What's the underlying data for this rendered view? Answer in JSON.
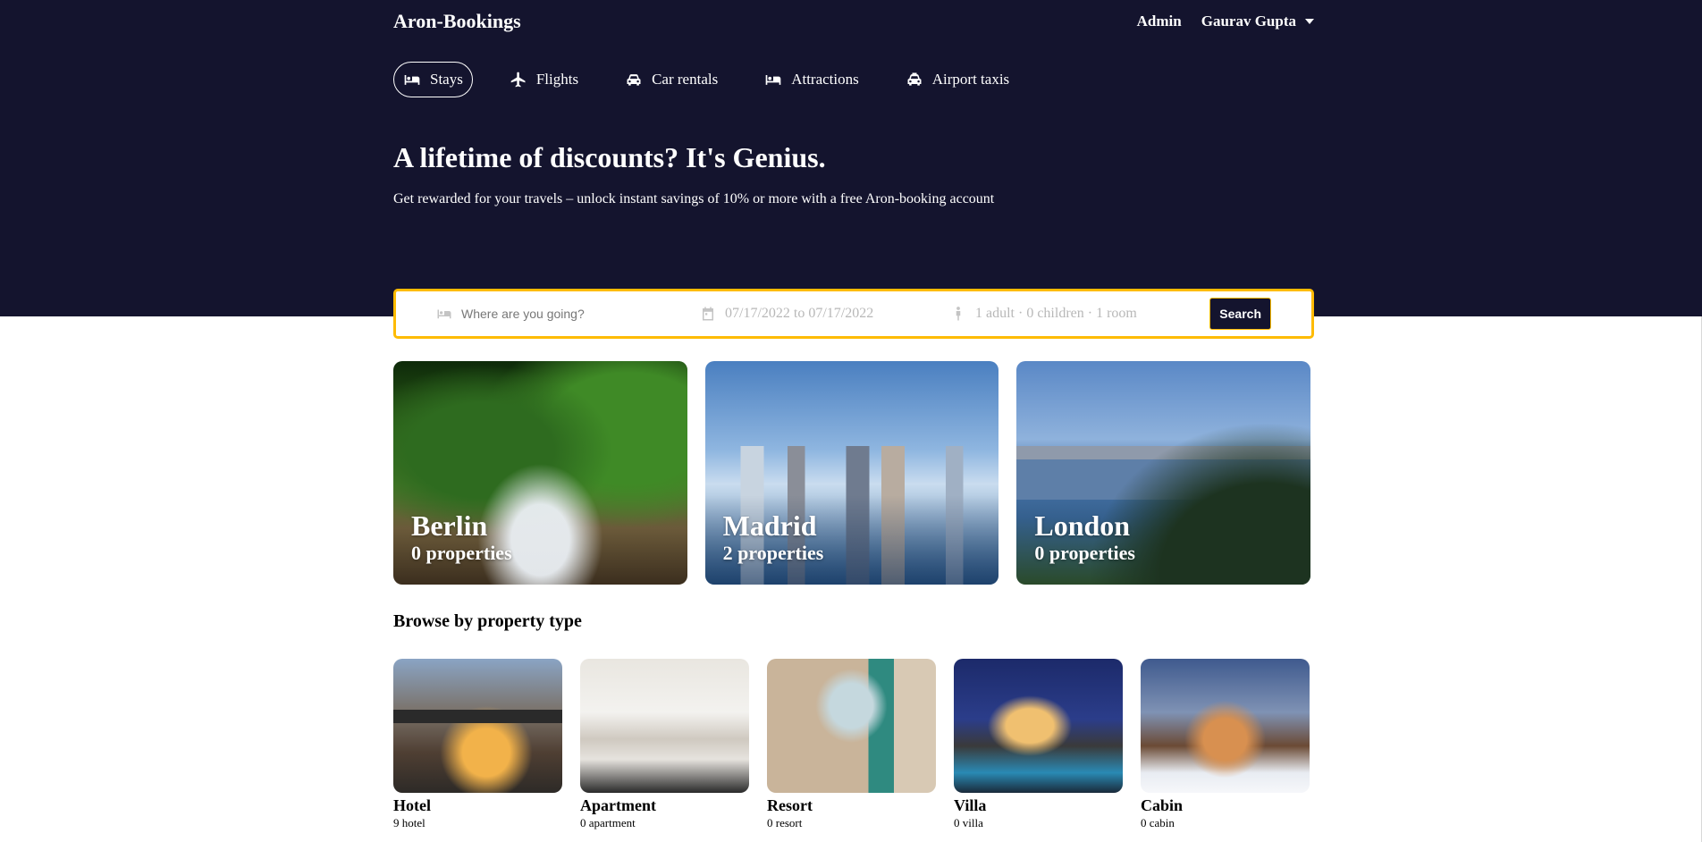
{
  "app": {
    "logo": "Aron-Bookings"
  },
  "topbar": {
    "admin_label": "Admin",
    "user_name": "Gaurav Gupta"
  },
  "nav": {
    "items": [
      {
        "label": "Stays",
        "icon": "bed-icon",
        "active": true
      },
      {
        "label": "Flights",
        "icon": "plane-icon"
      },
      {
        "label": "Car rentals",
        "icon": "car-icon"
      },
      {
        "label": "Attractions",
        "icon": "bed-icon"
      },
      {
        "label": "Airport taxis",
        "icon": "taxi-icon"
      }
    ]
  },
  "hero": {
    "title": "A lifetime of discounts? It's Genius.",
    "subtitle": "Get rewarded for your travels – unlock instant savings of 10% or more with a free Aron-booking account"
  },
  "search": {
    "destination_placeholder": "Where are you going?",
    "dates": "07/17/2022 to 07/17/2022",
    "options": "1 adult · 0 children · 1 room",
    "button": "Search"
  },
  "featured": [
    {
      "city": "Berlin",
      "properties": "0 properties"
    },
    {
      "city": "Madrid",
      "properties": "2 properties"
    },
    {
      "city": "London",
      "properties": "0 properties"
    }
  ],
  "property_types": {
    "title": "Browse by property type",
    "items": [
      {
        "name": "Hotel",
        "count": "9 hotel"
      },
      {
        "name": "Apartment",
        "count": "0 apartment"
      },
      {
        "name": "Resort",
        "count": "0 resort"
      },
      {
        "name": "Villa",
        "count": "0 villa"
      },
      {
        "name": "Cabin",
        "count": "0 cabin"
      }
    ]
  },
  "colors": {
    "header_bg": "#14142e",
    "search_border": "#febb02"
  }
}
